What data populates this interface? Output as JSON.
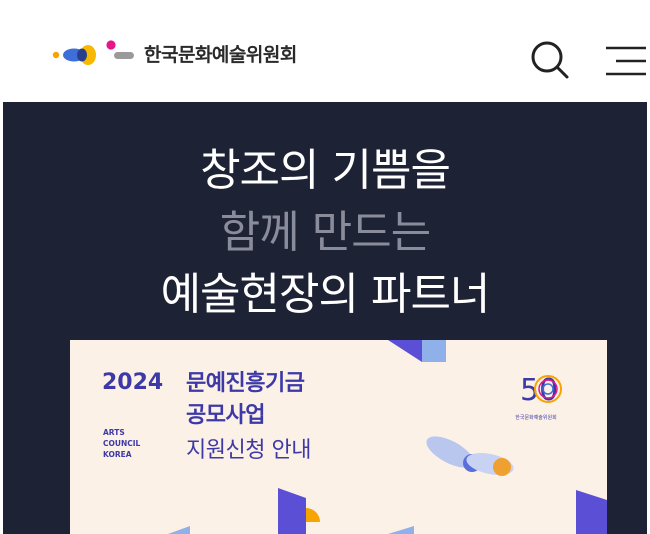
{
  "header": {
    "org_name": "한국문화예술위원회",
    "search_icon": "search-icon",
    "menu_icon": "hamburger-menu-icon"
  },
  "hero": {
    "line1": "창조의 기쁨을",
    "line2": "함께 만드는",
    "line3": "예술현장의 파트너",
    "background": "#1e2235"
  },
  "poster": {
    "year": "2024",
    "org_line1": "ARTS",
    "org_line2": "COUNCIL",
    "org_line3": "KOREA",
    "title_line1": "문예진흥기금",
    "title_line2": "공모사업",
    "subtitle": "지원신청 안내",
    "emblem_number": "50",
    "emblem_caption": "한국문화예술위원회",
    "accent": "#3d3aa8",
    "background": "#fcf1e6"
  }
}
